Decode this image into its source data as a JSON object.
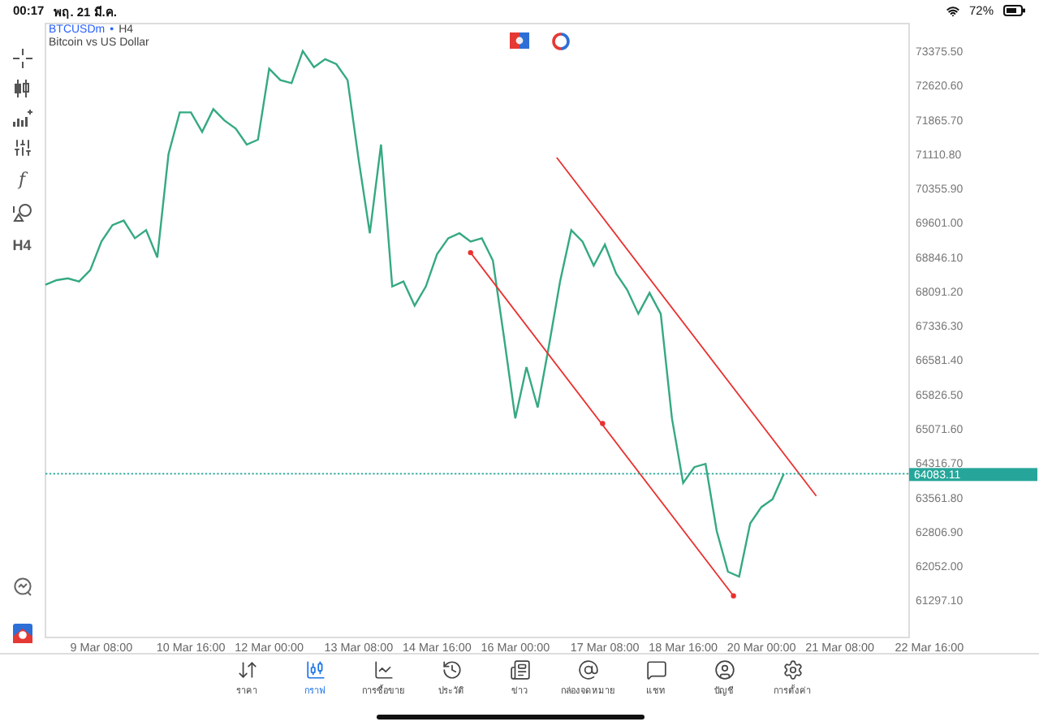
{
  "status_bar": {
    "time": "00:17",
    "date": "พฤ. 21 มี.ค.",
    "battery": "72%"
  },
  "left_toolbar": {
    "function_label": "f",
    "timeframe": "H4"
  },
  "chart_header": {
    "symbol": "BTCUSDm",
    "separator": "•",
    "timeframe": "H4",
    "description": "Bitcoin vs US Dollar"
  },
  "chart": {
    "current_price": "64083.11",
    "drawings": [
      {
        "kind": "trendline",
        "handles": true
      },
      {
        "kind": "trendline",
        "handles": false
      }
    ],
    "chart_data": {
      "type": "line",
      "categories": [
        null,
        null,
        null,
        null,
        null,
        "9 Mar 08:00",
        null,
        null,
        null,
        null,
        null,
        null,
        null,
        "10 Mar 16:00",
        null,
        null,
        null,
        null,
        null,
        null,
        "12 Mar 00:00",
        null,
        null,
        null,
        null,
        null,
        null,
        null,
        "13 Mar 08:00",
        null,
        null,
        null,
        null,
        null,
        null,
        "14 Mar 16:00",
        null,
        null,
        null,
        null,
        null,
        null,
        "16 Mar 00:00",
        null,
        null,
        null,
        null,
        null,
        null,
        null,
        "17 Mar 08:00",
        null,
        null,
        null,
        null,
        null,
        null,
        "18 Mar 16:00",
        null,
        null,
        null,
        null,
        null,
        null,
        "20 Mar 00:00",
        null,
        null,
        null,
        null,
        null,
        null,
        "21 Mar 08:00",
        null,
        null,
        null,
        null,
        null,
        null,
        null,
        "22 Mar 16:00"
      ],
      "series": [
        {
          "color": "#35a982",
          "values": [
            68240,
            68340,
            68380,
            68310,
            68560,
            69190,
            69550,
            69650,
            69260,
            69440,
            68840,
            71110,
            72030,
            72030,
            71600,
            72100,
            71850,
            71670,
            71320,
            71430,
            72990,
            72740,
            72670,
            73380,
            73020,
            73200,
            73090,
            72740,
            70970,
            69370,
            71320,
            68200,
            68310,
            67780,
            68200,
            68910,
            69260,
            69370,
            69190,
            69260,
            68770,
            67070,
            65300,
            66430,
            65540,
            66890,
            68310,
            69440,
            69190,
            68660,
            69120,
            68490,
            68130,
            67600,
            68060,
            67600,
            65300,
            63880,
            64230,
            64300,
            62820,
            61930,
            61820,
            62990,
            63350,
            63520,
            64080,
            null,
            null,
            null,
            null,
            null,
            null,
            null,
            null,
            null,
            null,
            null,
            null,
            null
          ]
        }
      ],
      "ylim": [
        60500,
        74000
      ],
      "yticks": [
        {
          "value": 73375.5,
          "label": "73375.50"
        },
        {
          "value": 72620.6,
          "label": "72620.60"
        },
        {
          "value": 71865.7,
          "label": "71865.70"
        },
        {
          "value": 71110.8,
          "label": "71110.80"
        },
        {
          "value": 70355.9,
          "label": "70355.90"
        },
        {
          "value": 69601,
          "label": "69601.00"
        },
        {
          "value": 68846.1,
          "label": "68846.10"
        },
        {
          "value": 68091.2,
          "label": "68091.20"
        },
        {
          "value": 67336.3,
          "label": "67336.30"
        },
        {
          "value": 66581.4,
          "label": "66581.40"
        },
        {
          "value": 65826.5,
          "label": "65826.50"
        },
        {
          "value": 65071.6,
          "label": "65071.60"
        },
        {
          "value": 64316.7,
          "label": "64316.70"
        },
        {
          "value": 63561.8,
          "label": "63561.80"
        },
        {
          "value": 62806.9,
          "label": "62806.90"
        },
        {
          "value": 62052,
          "label": "62052.00"
        },
        {
          "value": 61297.1,
          "label": "61297.10"
        }
      ]
    }
  },
  "tabs": [
    {
      "kind": "quotes",
      "label": "ราคา",
      "selected": false
    },
    {
      "kind": "chart",
      "label": "กราฟ",
      "selected": true
    },
    {
      "kind": "trade",
      "label": "การซื้อขาย",
      "selected": false
    },
    {
      "kind": "history",
      "label": "ประวัติ",
      "selected": false
    },
    {
      "kind": "news",
      "label": "ข่าว",
      "selected": false
    },
    {
      "kind": "mail",
      "label": "กล่องจดหมาย",
      "selected": false
    },
    {
      "kind": "chat",
      "label": "แชท",
      "selected": false
    },
    {
      "kind": "account",
      "label": "บัญชี",
      "selected": false
    },
    {
      "kind": "settings",
      "label": "การตั้งค่า",
      "selected": false
    }
  ]
}
